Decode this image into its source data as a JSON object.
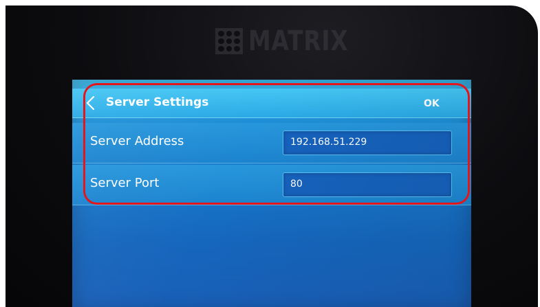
{
  "device": {
    "brand": "MATRIX"
  },
  "header": {
    "back_icon": "chevron-left-icon",
    "title": "Server Settings",
    "ok_label": "OK"
  },
  "fields": [
    {
      "label": "Server Address",
      "value": "192.168.51.229"
    },
    {
      "label": "Server Port",
      "value": "80"
    }
  ],
  "colors": {
    "screen_blue": "#1877c9",
    "header_blue": "#2aa9e6",
    "field_border": "#5bc0f2",
    "annotation_red": "#e4161c",
    "bezel": "#0c0c0f"
  }
}
